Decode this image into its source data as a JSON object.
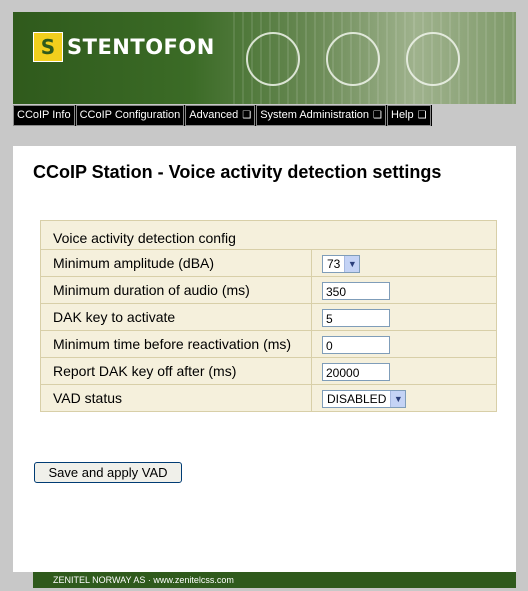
{
  "brand": {
    "name": "STENTOFON",
    "mark": "S"
  },
  "nav": [
    {
      "label": "CCoIP Info",
      "has_menu": false
    },
    {
      "label": "CCoIP Configuration",
      "has_menu": false
    },
    {
      "label": "Advanced",
      "has_menu": true
    },
    {
      "label": "System Administration",
      "has_menu": true
    },
    {
      "label": "Help",
      "has_menu": true
    }
  ],
  "page": {
    "title": "CCoIP Station - Voice activity detection settings"
  },
  "config": {
    "header": "Voice activity detection config",
    "min_amplitude": {
      "label": "Minimum amplitude (dBA)",
      "value": "73"
    },
    "min_duration": {
      "label": "Minimum duration of audio (ms)",
      "value": "350"
    },
    "dak_key": {
      "label": "DAK key to activate",
      "value": "5"
    },
    "min_reactivation": {
      "label": "Minimum time before reactivation (ms)",
      "value": "0"
    },
    "dak_off": {
      "label": "Report DAK key off after (ms)",
      "value": "20000"
    },
    "vad_status": {
      "label": "VAD status",
      "value": "DISABLED"
    }
  },
  "buttons": {
    "save": "Save and apply VAD"
  },
  "footer": {
    "text": "ZENITEL NORWAY AS · www.zenitelcss.com"
  }
}
